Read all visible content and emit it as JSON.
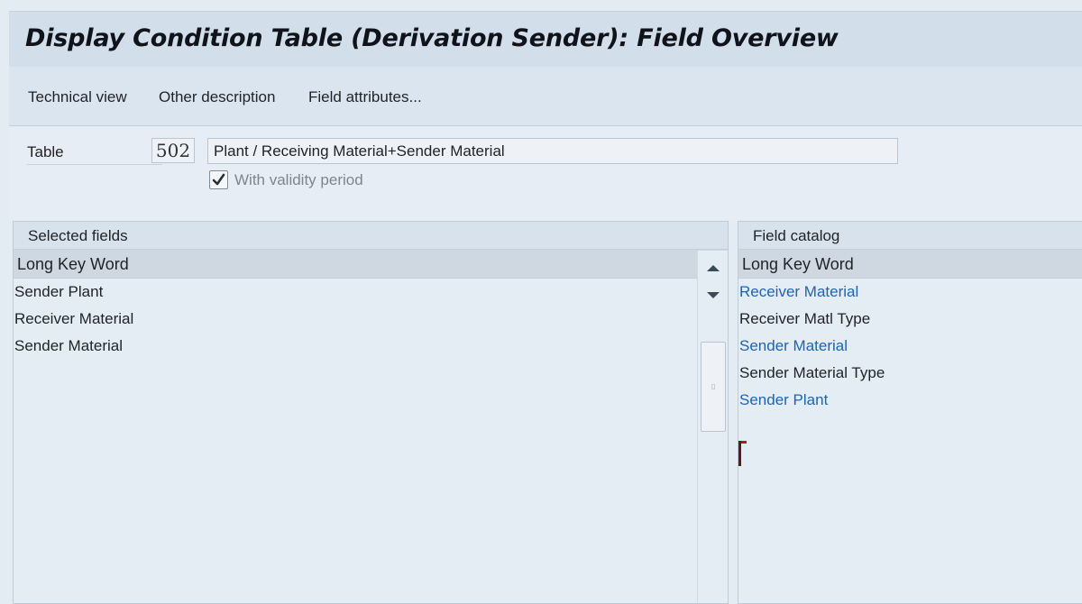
{
  "header": {
    "title": "Display Condition Table (Derivation Sender): Field Overview"
  },
  "toolbar": {
    "technical_view": "Technical view",
    "other_description": "Other description",
    "field_attributes": "Field attributes..."
  },
  "form": {
    "table_label": "Table",
    "table_number": "502",
    "table_description": "Plant / Receiving Material+Sender Material",
    "validity_checked": true,
    "validity_label": "With validity period"
  },
  "selected_fields": {
    "title": "Selected fields",
    "column_header": "Long Key Word",
    "rows": [
      "Sender Plant",
      "Receiver Material",
      "Sender Material"
    ]
  },
  "field_catalog": {
    "title": "Field catalog",
    "column_header": "Long Key Word",
    "rows": [
      {
        "label": "Receiver Material",
        "link": true
      },
      {
        "label": "Receiver Matl Type",
        "link": false
      },
      {
        "label": "Sender Material",
        "link": true
      },
      {
        "label": "Sender Material Type",
        "link": false
      },
      {
        "label": "Sender Plant",
        "link": true
      }
    ]
  },
  "icons": {
    "column_settings": "column-settings-icon",
    "scroll_up": "chevron-up-icon",
    "scroll_down": "chevron-down-icon",
    "checkbox": "checkmark-icon"
  },
  "colors": {
    "link": "#1d64b2",
    "accent_mark": "#a3201e"
  }
}
